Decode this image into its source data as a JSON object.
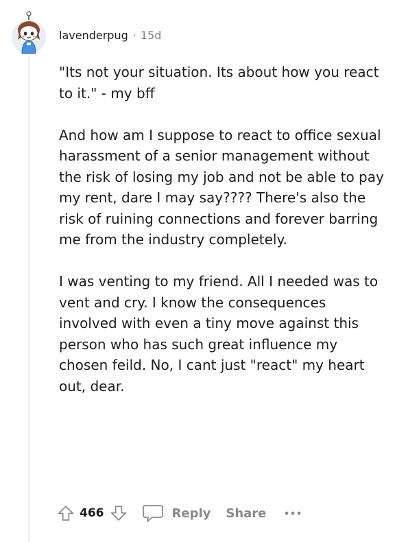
{
  "comment": {
    "username": "lavenderpug",
    "separator": "·",
    "timestamp": "15d",
    "paragraphs": [
      "\"Its not your situation. Its about how you react to it.\" - my bff",
      "And how am I suppose to react to office sexual harassment of a senior management without the risk of losing my job and not be able to pay my rent, dare I may say???? There's also the risk of ruining connections and forever barring me from the industry completely.",
      "I was venting to my friend. All I needed was to vent and cry. I know the consequences involved with even a tiny move against this person who has such great influence my chosen feild. No, I cant just \"react\" my heart out, dear."
    ],
    "score": "466"
  },
  "actions": {
    "reply_label": "Reply",
    "share_label": "Share"
  },
  "icons": {
    "avatar": "snoo-avatar",
    "upvote": "upvote-arrow-icon",
    "downvote": "downvote-arrow-icon",
    "reply": "speech-bubble-icon",
    "more": "ellipsis-icon"
  },
  "colors": {
    "text": "#1c1c1c",
    "muted": "#7c7c7c",
    "action": "#878a8c",
    "thread_line": "#edeff1",
    "avatar_bg": "#e9eef4"
  }
}
